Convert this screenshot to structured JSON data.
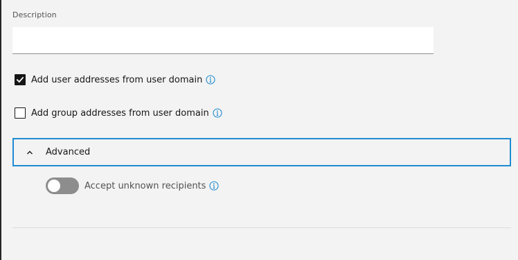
{
  "description_field": {
    "label": "Description",
    "value": "",
    "placeholder": ""
  },
  "options": {
    "add_user_addresses": {
      "label": "Add user addresses from user domain",
      "checked": true,
      "info_icon": "info-circle-icon"
    },
    "add_group_addresses": {
      "label": "Add group addresses from user domain",
      "checked": false,
      "info_icon": "info-circle-icon"
    }
  },
  "advanced": {
    "title": "Advanced",
    "expanded": true,
    "icon": "chevron-up-icon",
    "accept_unknown_recipients": {
      "label": "Accept unknown recipients",
      "enabled": false,
      "info_icon": "info-circle-icon"
    }
  },
  "colors": {
    "accent": "#1f8ad1",
    "toggle_off": "#8d8d8d",
    "checkbox_checked": "#161616",
    "background": "#f3f3f3"
  }
}
